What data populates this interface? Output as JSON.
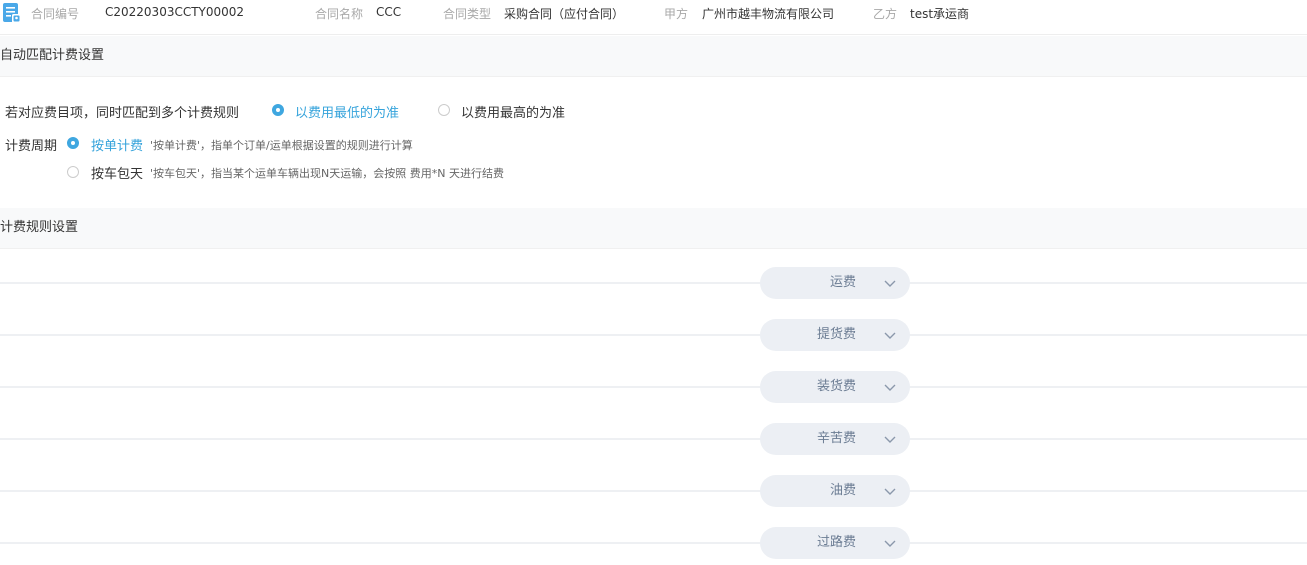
{
  "header": {
    "contract_no_label": "合同编号",
    "contract_no_value": "C20220303CCTY00002",
    "contract_name_label": "合同名称",
    "contract_name_value": "CCC",
    "contract_type_label": "合同类型",
    "contract_type_value": "采购合同（应付合同）",
    "party_a_label": "甲方",
    "party_a_value": "广州市越丰物流有限公司",
    "party_b_label": "乙方",
    "party_b_value": "test承运商"
  },
  "auto_match": {
    "title": "自动匹配计费设置",
    "multi_rule_label": "若对应费目项，同时匹配到多个计费规则",
    "multi_rule_options": [
      {
        "label": "以费用最低的为准",
        "checked": true
      },
      {
        "label": "以费用最高的为准",
        "checked": false
      }
    ],
    "cycle_label": "计费周期",
    "cycle_options": [
      {
        "label": "按单计费",
        "hint": "'按单计费'，指单个订单/运单根据设置的规则进行计算",
        "checked": true
      },
      {
        "label": "按车包天",
        "hint": "'按车包天'，指当某个运单车辆出现N天运输，会按照 费用*N 天进行结费",
        "checked": false
      }
    ]
  },
  "rules": {
    "title": "计费规则设置",
    "items": [
      {
        "label": "运费",
        "icon": "chevron-down-icon"
      },
      {
        "label": "提货费",
        "icon": "chevron-down-icon"
      },
      {
        "label": "装货费",
        "icon": "chevron-down-icon"
      },
      {
        "label": "辛苦费",
        "icon": "chevron-down-icon"
      },
      {
        "label": "油费",
        "icon": "chevron-down-icon"
      },
      {
        "label": "过路费",
        "icon": "chevron-down-icon"
      }
    ]
  },
  "colors": {
    "accent": "#3fa7e0",
    "pill_bg": "#eceff4",
    "pill_text": "#6b7c93"
  }
}
